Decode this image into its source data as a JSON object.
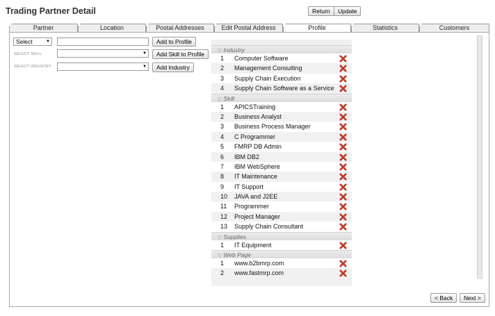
{
  "header": {
    "title": "Trading Partner Detail",
    "return_label": "Return",
    "update_label": "Update"
  },
  "tabs": [
    {
      "label": "Partner",
      "active": false
    },
    {
      "label": "Location",
      "active": false
    },
    {
      "label": "Postal Addresses",
      "active": false
    },
    {
      "label": "Edit Postal Address",
      "active": false
    },
    {
      "label": "Profile",
      "active": true
    },
    {
      "label": "Statistics",
      "active": false
    },
    {
      "label": "Customers",
      "active": false
    }
  ],
  "form": {
    "type_select_value": "Select",
    "add_to_profile_label": "Add to Profile",
    "select_skill_label": "SELECT SKILL",
    "add_skill_label": "Add Skill to Profile",
    "select_industry_label": "SELECT INDUSTRY",
    "add_industry_label": "Add Industry"
  },
  "profile": {
    "groups": [
      {
        "title": "Industry",
        "items": [
          {
            "num": "1",
            "name": "Computer Software"
          },
          {
            "num": "2",
            "name": "Management Consulting"
          },
          {
            "num": "3",
            "name": "Supply Chain Execution"
          },
          {
            "num": "4",
            "name": "Supply Chain Software as a Service"
          }
        ]
      },
      {
        "title": "Skill",
        "items": [
          {
            "num": "1",
            "name": "APICSTraining"
          },
          {
            "num": "2",
            "name": "Business Analyst"
          },
          {
            "num": "3",
            "name": "Business Process Manager"
          },
          {
            "num": "4",
            "name": "C Programmer"
          },
          {
            "num": "5",
            "name": "FMRP DB Admin"
          },
          {
            "num": "6",
            "name": "IBM DB2"
          },
          {
            "num": "7",
            "name": "IBM WebSphere"
          },
          {
            "num": "8",
            "name": "IT Maintenance"
          },
          {
            "num": "9",
            "name": "IT Support"
          },
          {
            "num": "10",
            "name": "JAVA and J2EE"
          },
          {
            "num": "11",
            "name": "Programmer"
          },
          {
            "num": "12",
            "name": "Project Manager"
          },
          {
            "num": "13",
            "name": "Supply Chain Consultant"
          }
        ]
      },
      {
        "title": "Supplies",
        "items": [
          {
            "num": "1",
            "name": "IT Equipment"
          }
        ]
      },
      {
        "title": "Web Page",
        "items": [
          {
            "num": "1",
            "name": "www.b2bmrp.com"
          },
          {
            "num": "2",
            "name": "www.fastmrp.com"
          }
        ]
      }
    ]
  },
  "footer": {
    "back_label": "< Back",
    "next_label": "Next >"
  },
  "colors": {
    "delete_icon": "#c0392b"
  }
}
